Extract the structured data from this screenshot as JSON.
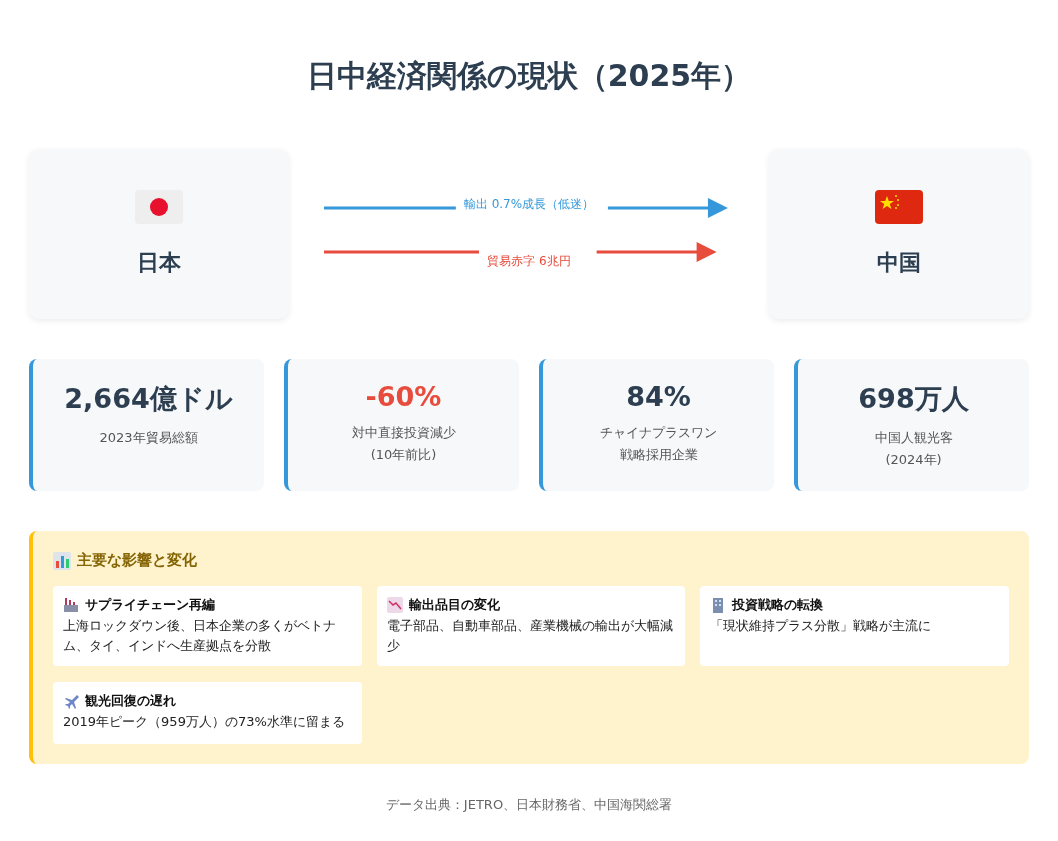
{
  "title": "日中経済関係の現状（2025年）",
  "countries": [
    {
      "name": "日本"
    },
    {
      "name": "中国"
    }
  ],
  "flows": [
    {
      "label": "輸出 0.7%成長（低迷）",
      "color": "#3498db"
    },
    {
      "label": "貿易赤字 6兆円",
      "color": "#e74c3c"
    }
  ],
  "stats": [
    {
      "value": "2,664億ドル",
      "color": "#2c3e50",
      "lines": [
        "2023年貿易総額"
      ]
    },
    {
      "value": "-60%",
      "color": "#e74c3c",
      "lines": [
        "対中直接投資減少",
        "(10年前比)"
      ]
    },
    {
      "value": "84%",
      "color": "#2c3e50",
      "lines": [
        "チャイナプラスワン",
        "戦略採用企業"
      ]
    },
    {
      "value": "698万人",
      "color": "#2c3e50",
      "lines": [
        "中国人観光客",
        "(2024年)"
      ]
    }
  ],
  "impacts": {
    "heading": "主要な影響と変化",
    "items": [
      {
        "title": "サプライチェーン再編",
        "text": "上海ロックダウン後、日本企業の多くがベトナム、タイ、インドへ生産拠点を分散"
      },
      {
        "title": "輸出品目の変化",
        "text": "電子部品、自動車部品、産業機械の輸出が大幅減少"
      },
      {
        "title": "投資戦略の転換",
        "text": "「現状維持プラス分散」戦略が主流に"
      },
      {
        "title": "観光回復の遅れ",
        "text": "2019年ピーク（959万人）の73%水準に留まる"
      }
    ]
  },
  "footer": "データ出典：JETRO、日本財務省、中国海関総署"
}
